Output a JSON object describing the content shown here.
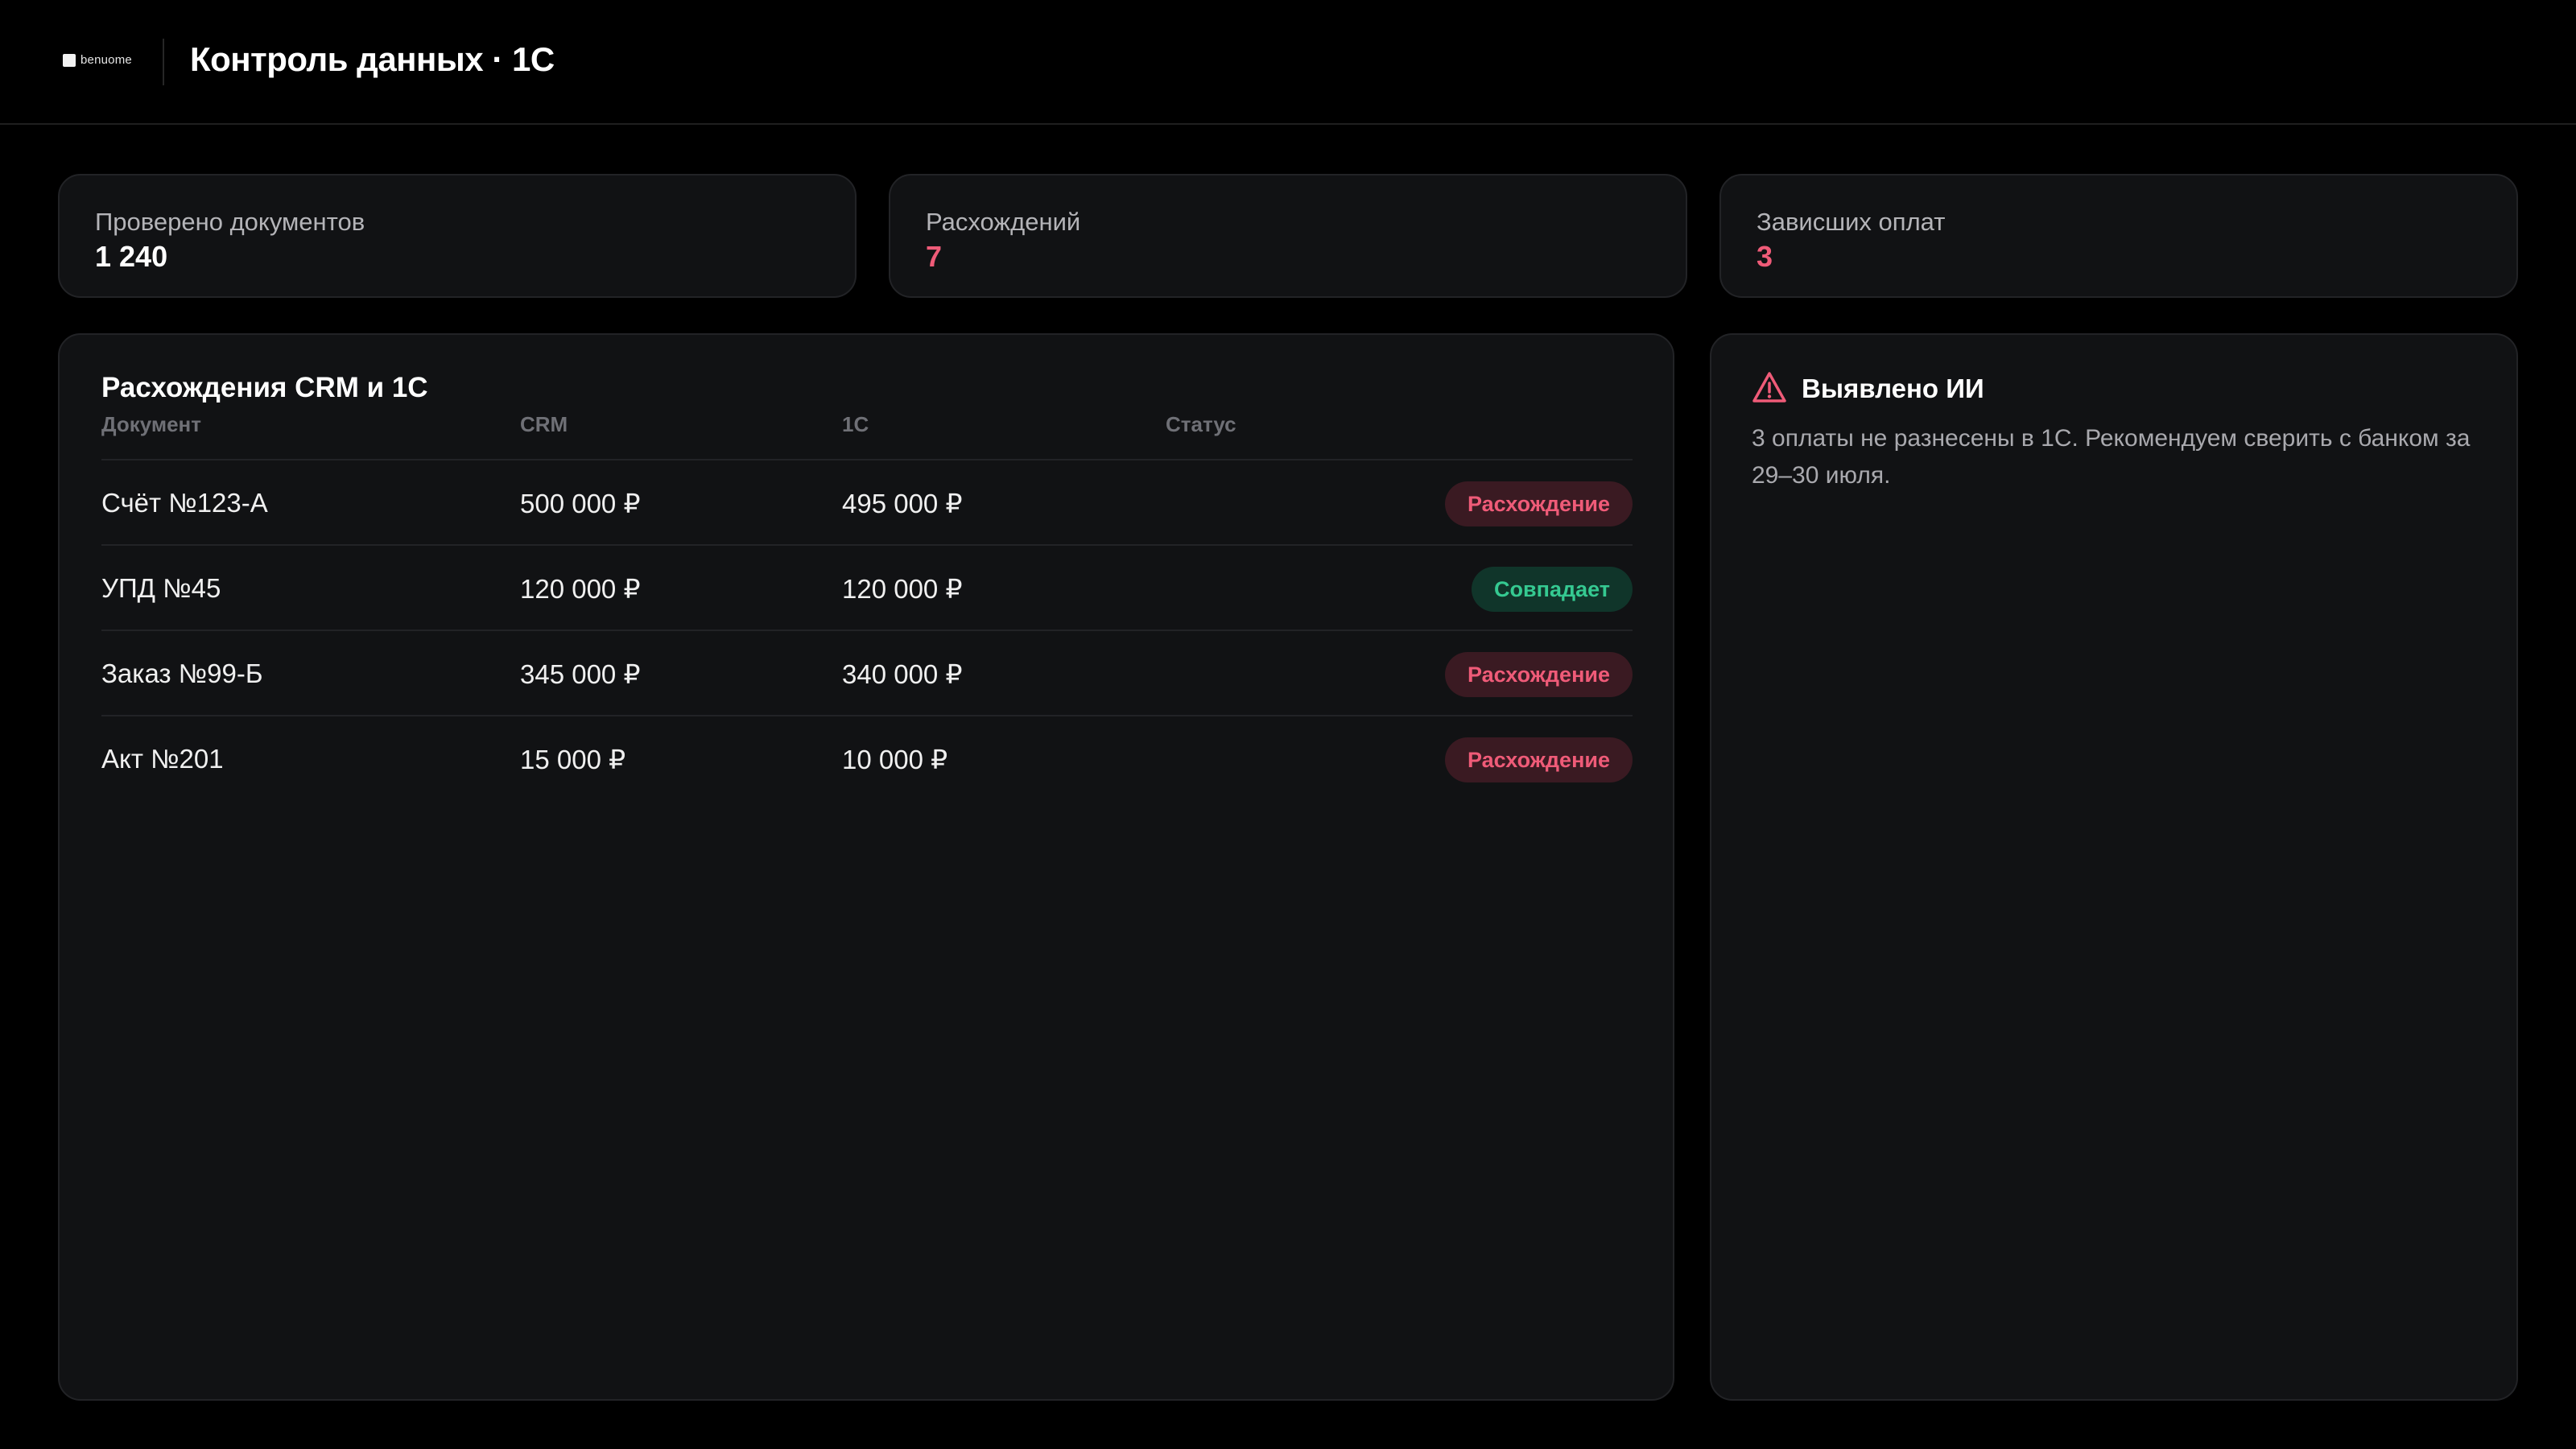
{
  "header": {
    "logo_text": "benuome",
    "title": "Контроль данных · 1С"
  },
  "stats": [
    {
      "label": "Проверено документов",
      "value": "1 240",
      "accent": "#ffffff"
    },
    {
      "label": "Расхождений",
      "value": "7",
      "accent": "#ef5b78"
    },
    {
      "label": "Зависших оплат",
      "value": "3",
      "accent": "#ef5b78"
    }
  ],
  "table": {
    "title": "Расхождения CRM и 1С",
    "columns": [
      "Документ",
      "CRM",
      "1С",
      "Статус"
    ],
    "rows": [
      {
        "document": "Счёт №123-А",
        "crm": "500 000 ₽",
        "one_c": "495 000 ₽",
        "status": "Расхождение",
        "status_type": "mismatch"
      },
      {
        "document": "УПД №45",
        "crm": "120 000 ₽",
        "one_c": "120 000 ₽",
        "status": "Совпадает",
        "status_type": "match"
      },
      {
        "document": "Заказ №99-Б",
        "crm": "345 000 ₽",
        "one_c": "340 000 ₽",
        "status": "Расхождение",
        "status_type": "mismatch"
      },
      {
        "document": "Акт №201",
        "crm": "15 000 ₽",
        "one_c": "10 000 ₽",
        "status": "Расхождение",
        "status_type": "mismatch"
      }
    ]
  },
  "ai_panel": {
    "icon": "warning-triangle-icon",
    "title": "Выявлено ИИ",
    "text": "3 оплаты не разнесены в 1С. Рекомендуем сверить с банком за 29–30 июля."
  },
  "colors": {
    "background": "#000000",
    "card": "#111214",
    "danger": "#ef5b78",
    "success": "#35c991"
  }
}
